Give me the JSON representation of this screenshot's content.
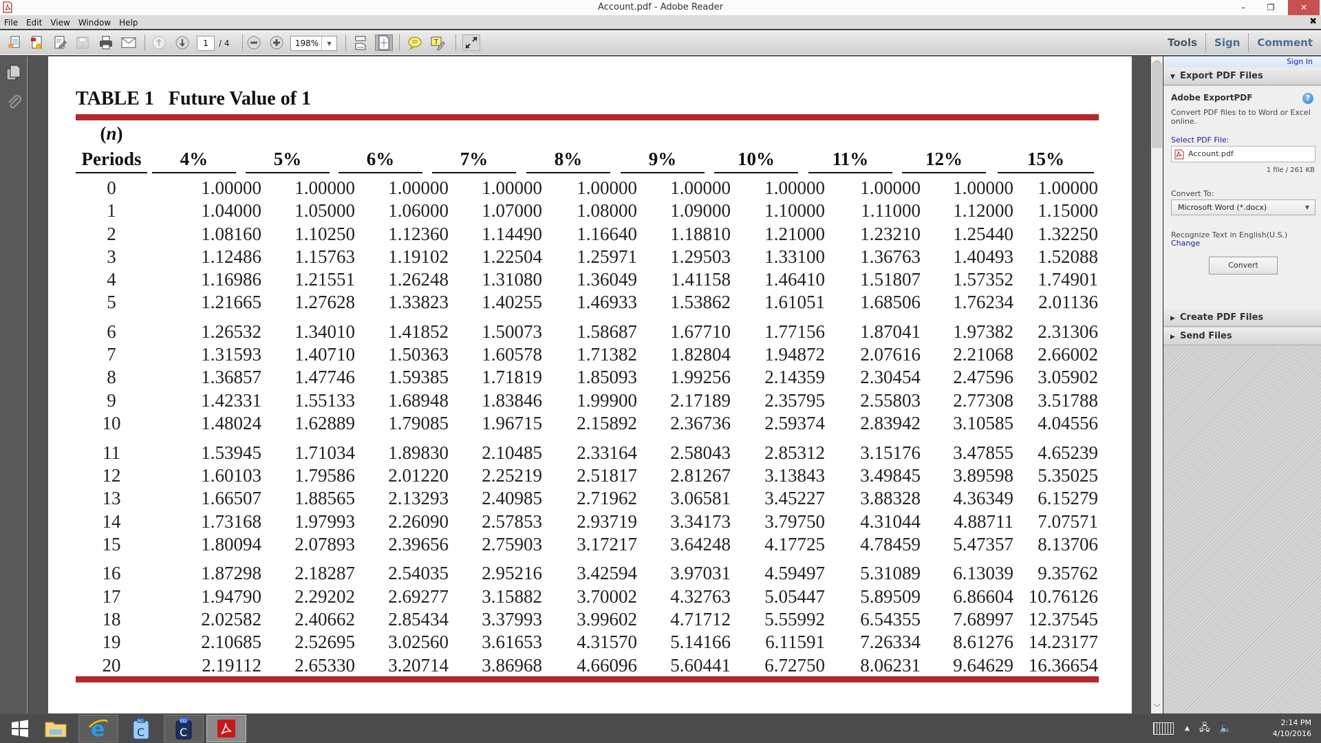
{
  "window": {
    "title": "Account.pdf - Adobe Reader",
    "icon": "adobe-reader-icon",
    "controls": {
      "minimize": "–",
      "maximize": "❐",
      "close": "✕"
    }
  },
  "menubar": {
    "items": [
      {
        "label": "File"
      },
      {
        "label": "Edit"
      },
      {
        "label": "View"
      },
      {
        "label": "Window"
      },
      {
        "label": "Help"
      }
    ],
    "close_doc": "✖"
  },
  "toolbar": {
    "buttons": [
      {
        "name": "create-pdf-icon"
      },
      {
        "name": "export-pdf-icon"
      },
      {
        "name": "edit-pdf-icon"
      },
      {
        "name": "save-icon"
      },
      {
        "name": "print-icon"
      },
      {
        "name": "email-icon"
      },
      {
        "name": "previous-page-icon"
      },
      {
        "name": "next-page-icon"
      },
      {
        "name": "zoom-out-icon"
      },
      {
        "name": "zoom-in-icon"
      },
      {
        "name": "scrolling-mode-icon"
      },
      {
        "name": "fit-page-icon"
      },
      {
        "name": "sticky-note-icon"
      },
      {
        "name": "highlight-text-icon"
      },
      {
        "name": "full-screen-icon"
      }
    ],
    "page_current": "1",
    "page_total": "/ 4",
    "zoom_level": "198%",
    "right_tabs": {
      "tools": "Tools",
      "sign": "Sign",
      "comment": "Comment"
    }
  },
  "document": {
    "table_label": "TABLE 1",
    "table_title": "Future Value of 1",
    "period_header_line1_open": "(",
    "period_header_line1_n": "n",
    "period_header_line1_close": ")",
    "period_header_line2": "Periods",
    "rate_headers": [
      "4%",
      "5%",
      "6%",
      "7%",
      "8%",
      "9%",
      "10%",
      "11%",
      "12%",
      "15%"
    ],
    "rows": [
      {
        "n": "0",
        "values": [
          "1.00000",
          "1.00000",
          "1.00000",
          "1.00000",
          "1.00000",
          "1.00000",
          "1.00000",
          "1.00000",
          "1.00000",
          "1.00000"
        ]
      },
      {
        "n": "1",
        "values": [
          "1.04000",
          "1.05000",
          "1.06000",
          "1.07000",
          "1.08000",
          "1.09000",
          "1.10000",
          "1.11000",
          "1.12000",
          "1.15000"
        ]
      },
      {
        "n": "2",
        "values": [
          "1.08160",
          "1.10250",
          "1.12360",
          "1.14490",
          "1.16640",
          "1.18810",
          "1.21000",
          "1.23210",
          "1.25440",
          "1.32250"
        ]
      },
      {
        "n": "3",
        "values": [
          "1.12486",
          "1.15763",
          "1.19102",
          "1.22504",
          "1.25971",
          "1.29503",
          "1.33100",
          "1.36763",
          "1.40493",
          "1.52088"
        ]
      },
      {
        "n": "4",
        "values": [
          "1.16986",
          "1.21551",
          "1.26248",
          "1.31080",
          "1.36049",
          "1.41158",
          "1.46410",
          "1.51807",
          "1.57352",
          "1.74901"
        ]
      },
      {
        "n": "5",
        "values": [
          "1.21665",
          "1.27628",
          "1.33823",
          "1.40255",
          "1.46933",
          "1.53862",
          "1.61051",
          "1.68506",
          "1.76234",
          "2.01136"
        ]
      },
      {
        "n": "6",
        "values": [
          "1.26532",
          "1.34010",
          "1.41852",
          "1.50073",
          "1.58687",
          "1.67710",
          "1.77156",
          "1.87041",
          "1.97382",
          "2.31306"
        ]
      },
      {
        "n": "7",
        "values": [
          "1.31593",
          "1.40710",
          "1.50363",
          "1.60578",
          "1.71382",
          "1.82804",
          "1.94872",
          "2.07616",
          "2.21068",
          "2.66002"
        ]
      },
      {
        "n": "8",
        "values": [
          "1.36857",
          "1.47746",
          "1.59385",
          "1.71819",
          "1.85093",
          "1.99256",
          "2.14359",
          "2.30454",
          "2.47596",
          "3.05902"
        ]
      },
      {
        "n": "9",
        "values": [
          "1.42331",
          "1.55133",
          "1.68948",
          "1.83846",
          "1.99900",
          "2.17189",
          "2.35795",
          "2.55803",
          "2.77308",
          "3.51788"
        ]
      },
      {
        "n": "10",
        "values": [
          "1.48024",
          "1.62889",
          "1.79085",
          "1.96715",
          "2.15892",
          "2.36736",
          "2.59374",
          "2.83942",
          "3.10585",
          "4.04556"
        ]
      },
      {
        "n": "11",
        "values": [
          "1.53945",
          "1.71034",
          "1.89830",
          "2.10485",
          "2.33164",
          "2.58043",
          "2.85312",
          "3.15176",
          "3.47855",
          "4.65239"
        ]
      },
      {
        "n": "12",
        "values": [
          "1.60103",
          "1.79586",
          "2.01220",
          "2.25219",
          "2.51817",
          "2.81267",
          "3.13843",
          "3.49845",
          "3.89598",
          "5.35025"
        ]
      },
      {
        "n": "13",
        "values": [
          "1.66507",
          "1.88565",
          "2.13293",
          "2.40985",
          "2.71962",
          "3.06581",
          "3.45227",
          "3.88328",
          "4.36349",
          "6.15279"
        ]
      },
      {
        "n": "14",
        "values": [
          "1.73168",
          "1.97993",
          "2.26090",
          "2.57853",
          "2.93719",
          "3.34173",
          "3.79750",
          "4.31044",
          "4.88711",
          "7.07571"
        ]
      },
      {
        "n": "15",
        "values": [
          "1.80094",
          "2.07893",
          "2.39656",
          "2.75903",
          "3.17217",
          "3.64248",
          "4.17725",
          "4.78459",
          "5.47357",
          "8.13706"
        ]
      },
      {
        "n": "16",
        "values": [
          "1.87298",
          "2.18287",
          "2.54035",
          "2.95216",
          "3.42594",
          "3.97031",
          "4.59497",
          "5.31089",
          "6.13039",
          "9.35762"
        ]
      },
      {
        "n": "17",
        "values": [
          "1.94790",
          "2.29202",
          "2.69277",
          "3.15882",
          "3.70002",
          "4.32763",
          "5.05447",
          "5.89509",
          "6.86604",
          "10.76126"
        ]
      },
      {
        "n": "18",
        "values": [
          "2.02582",
          "2.40662",
          "2.85434",
          "3.37993",
          "3.99602",
          "4.71712",
          "5.55992",
          "6.54355",
          "7.68997",
          "12.37545"
        ]
      },
      {
        "n": "19",
        "values": [
          "2.10685",
          "2.52695",
          "3.02560",
          "3.61653",
          "4.31570",
          "5.14166",
          "6.11591",
          "7.26334",
          "8.61276",
          "14.23177"
        ]
      },
      {
        "n": "20",
        "values": [
          "2.19112",
          "2.65330",
          "3.20714",
          "3.86968",
          "4.66096",
          "5.60441",
          "6.72750",
          "8.06231",
          "9.64629",
          "16.36654"
        ]
      }
    ],
    "accent_color": "#b3292d"
  },
  "left_nav": {
    "items": [
      {
        "name": "page-thumbnails-icon"
      },
      {
        "name": "attachments-icon"
      }
    ]
  },
  "right_panel": {
    "sign_in": "Sign In",
    "export_section": "Export PDF Files",
    "service_title": "Adobe ExportPDF",
    "help": "?",
    "description": "Convert PDF files to to Word or Excel online.",
    "select_label": "Select PDF File:",
    "selected_file": "Account.pdf",
    "file_info": "1 file / 261 KB",
    "convert_to_label": "Convert To:",
    "convert_to_value": "Microsoft Word (*.docx)",
    "ocr_text": "Recognize Text in English(U.S.)",
    "change_link": "Change",
    "convert_button": "Convert",
    "create_section": "Create PDF Files",
    "send_section": "Send Files"
  },
  "taskbar": {
    "apps": [
      {
        "name": "start-button-icon"
      },
      {
        "name": "file-explorer-icon"
      },
      {
        "name": "internet-explorer-icon"
      },
      {
        "name": "bo-client-icon",
        "badge": "BO"
      },
      {
        "name": "fd-client-icon",
        "badge": "FD"
      },
      {
        "name": "adobe-reader-icon"
      }
    ],
    "time": "2:14 PM",
    "date": "4/10/2016"
  }
}
